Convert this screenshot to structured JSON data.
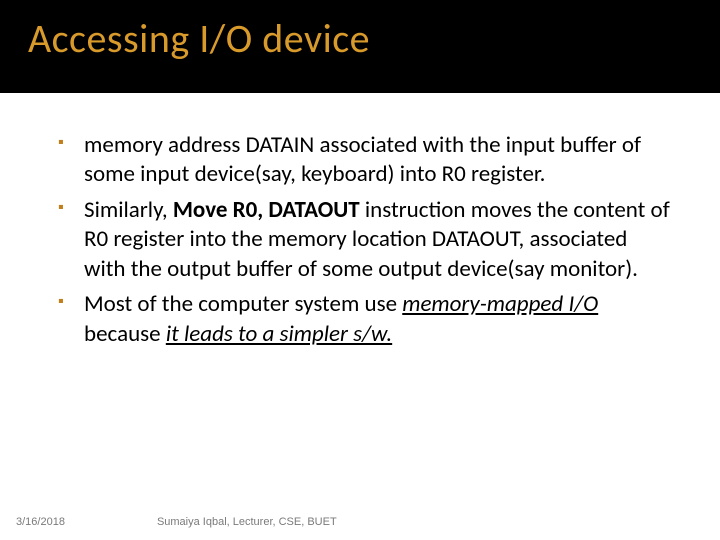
{
  "title": "Accessing I/O device",
  "bullets": [
    {
      "pre": "memory address DATAIN associated with the input buffer of some input device(say, keyboard) into R0 register."
    },
    {
      "pre": "Similarly, ",
      "bold": "Move R0, DATAOUT",
      "post": " instruction moves the content of R0 register into the memory location DATAOUT, associated with the output buffer of some output device(say monitor)."
    },
    {
      "pre": "Most of the computer system use ",
      "underline_italic1": "memory-mapped I/O",
      "mid": " because ",
      "underline_italic2": "it leads to a simpler s/w.",
      "post": ""
    }
  ],
  "footer": {
    "date": "3/16/2018",
    "author": "Sumaiya Iqbal, Lecturer, CSE, BUET"
  }
}
